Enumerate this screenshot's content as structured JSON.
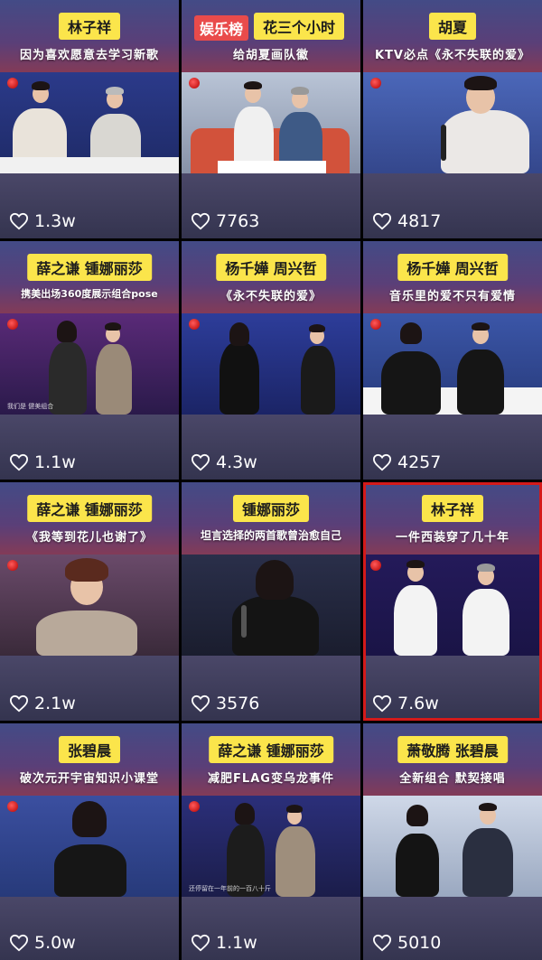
{
  "brand_badge": "娱乐榜",
  "tiles": [
    {
      "tag": "林子祥",
      "subtitle": "因为喜欢愿意去学习新歌",
      "likes": "1.3w",
      "caption": ""
    },
    {
      "tag": "花三个小时",
      "subtitle": "给胡夏画队徽",
      "likes": "7763",
      "caption": ""
    },
    {
      "tag": "胡夏",
      "subtitle": "KTV必点《永不失联的爱》",
      "likes": "4817",
      "caption": ""
    },
    {
      "tag": "薛之谦  锺娜丽莎",
      "subtitle": "携美出场360度展示组合pose",
      "likes": "1.1w",
      "caption": "我们是 健美组合"
    },
    {
      "tag": "杨千嬅  周兴哲",
      "subtitle": "《永不失联的爱》",
      "likes": "4.3w",
      "caption": ""
    },
    {
      "tag": "杨千嬅  周兴哲",
      "subtitle": "音乐里的爱不只有爱情",
      "likes": "4257",
      "caption": ""
    },
    {
      "tag": "薛之谦  锺娜丽莎",
      "subtitle": "《我等到花儿也谢了》",
      "likes": "2.1w",
      "caption": ""
    },
    {
      "tag": "锺娜丽莎",
      "subtitle": "坦言选择的两首歌曾治愈自己",
      "likes": "3576",
      "caption": ""
    },
    {
      "tag": "林子祥",
      "subtitle": "一件西装穿了几十年",
      "likes": "7.6w",
      "caption": ""
    },
    {
      "tag": "张碧晨",
      "subtitle": "破次元开宇宙知识小课堂",
      "likes": "5.0w",
      "caption": ""
    },
    {
      "tag": "薛之谦  锺娜丽莎",
      "subtitle": "减肥FLAG变乌龙事件",
      "likes": "1.1w",
      "caption": "还停留在一年前的一百八十斤"
    },
    {
      "tag": "萧敬腾  张碧晨",
      "subtitle": "全新组合  默契接唱",
      "likes": "5010",
      "caption": ""
    }
  ],
  "selected_index": 8,
  "colors": {
    "tag_bg": "#fbe54b",
    "selected_border": "#d41a1a",
    "brand_badge_bg": "#e94b4b"
  }
}
